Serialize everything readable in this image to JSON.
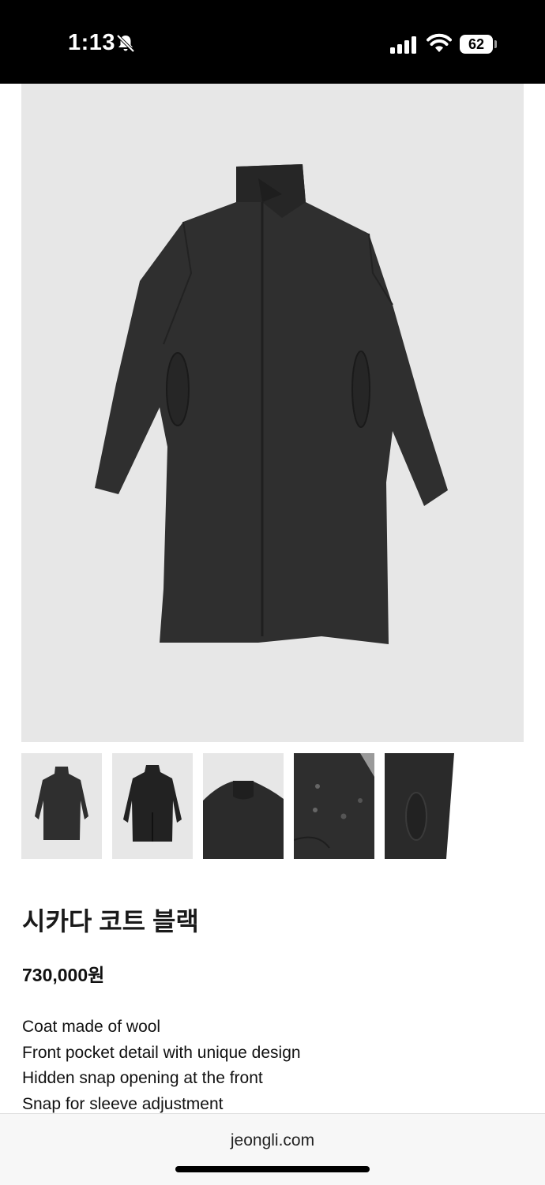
{
  "status_bar": {
    "time": "1:13",
    "battery": "62",
    "icons": [
      "bell-muted-icon",
      "cellular-signal-icon",
      "wifi-icon",
      "battery-icon"
    ]
  },
  "product": {
    "title": "시카다 코트 블랙",
    "price": "730,000원",
    "description": [
      "Coat made of wool",
      "Front pocket detail with unique design",
      "Hidden snap opening at the front",
      "Snap for sleeve adjustment"
    ],
    "color": "#2f2f2f",
    "thumbnails": [
      "front-view",
      "back-view",
      "collar-detail",
      "snap-detail",
      "pocket-detail"
    ]
  },
  "browser": {
    "url": "jeongli.com"
  }
}
